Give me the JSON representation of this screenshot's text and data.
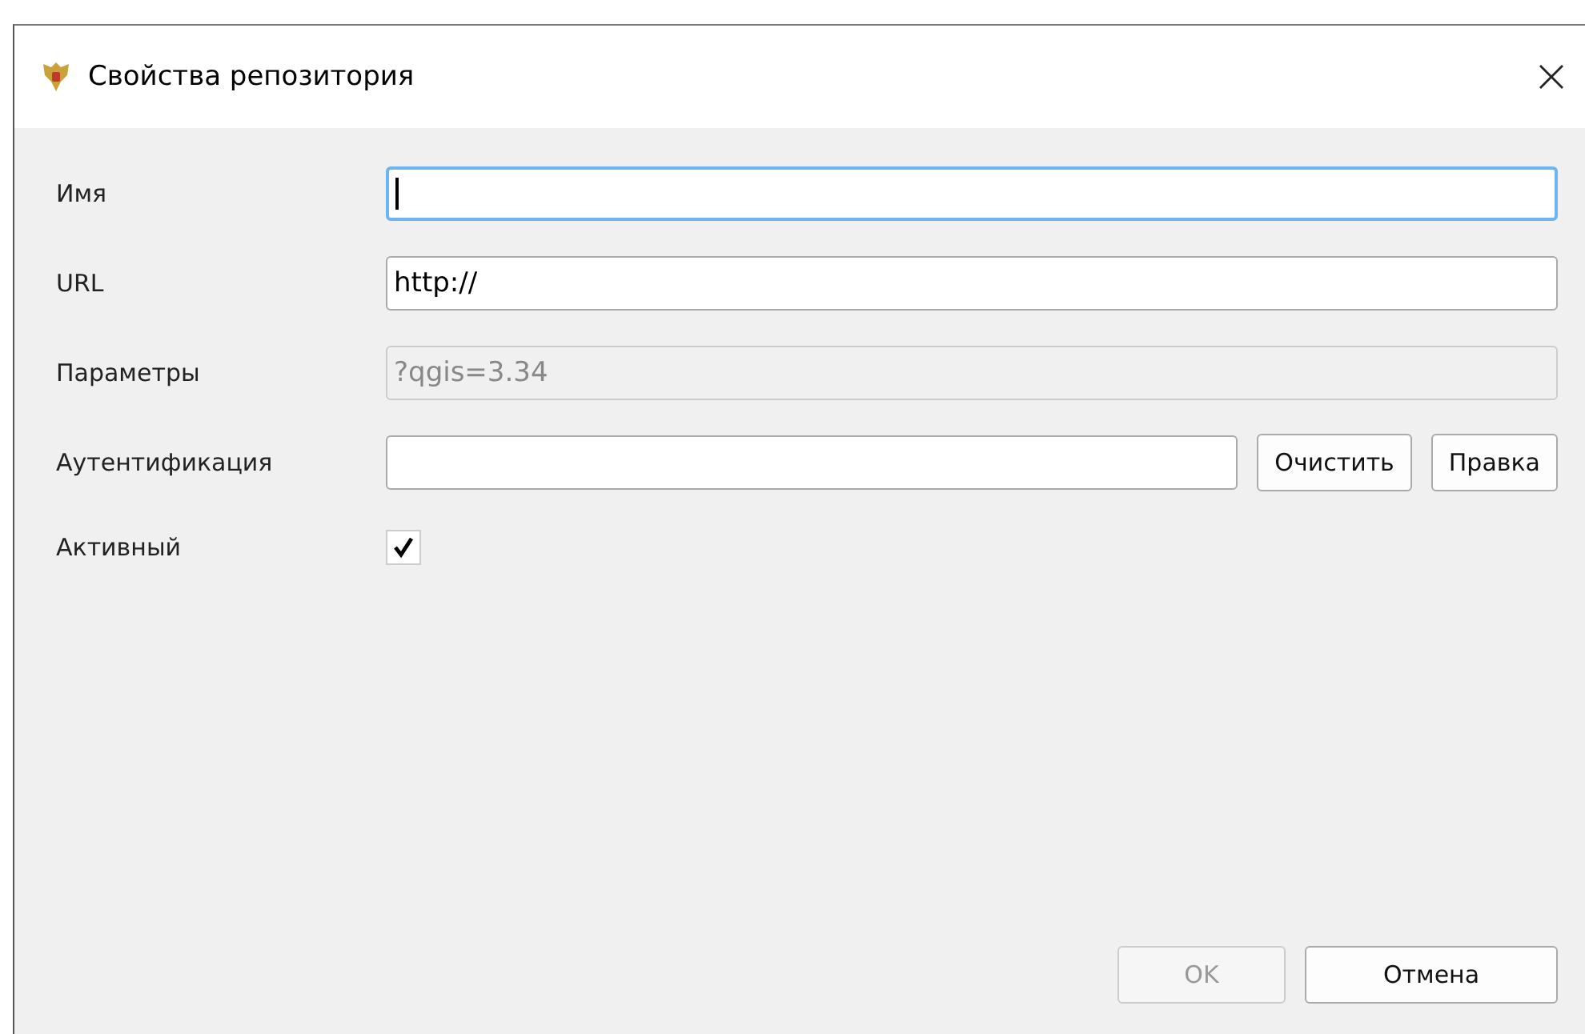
{
  "window": {
    "title": "Свойства репозитория"
  },
  "fields": [
    {
      "kind": "text",
      "label": "Имя",
      "focused": true,
      "disabled": false
    },
    {
      "kind": "text",
      "label": "URL",
      "value": "http://",
      "focused": false,
      "disabled": false
    },
    {
      "kind": "text",
      "label": "Параметры",
      "value": "?qgis=3.34",
      "focused": false,
      "disabled": true
    },
    {
      "kind": "auth",
      "label": "Аутентификация",
      "focused": false,
      "disabled": false,
      "buttons": [
        "Очистить",
        "Правка"
      ]
    },
    {
      "kind": "checkbox",
      "label": "Активный",
      "checked": true
    }
  ],
  "buttons": [
    {
      "label": "OK",
      "disabled": true
    },
    {
      "label": "Отмена",
      "disabled": false
    }
  ]
}
